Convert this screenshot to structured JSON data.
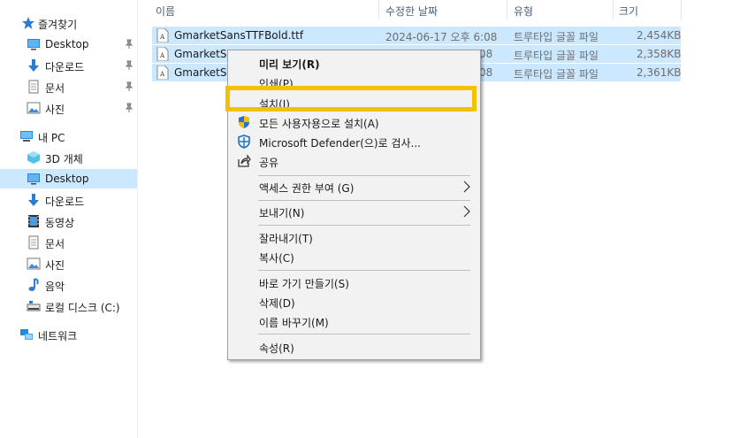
{
  "nav": {
    "quick_access": "즐겨찾기",
    "items_quick": [
      {
        "label": "Desktop",
        "icon": "desktop-icon"
      },
      {
        "label": "다운로드",
        "icon": "download-icon"
      },
      {
        "label": "문서",
        "icon": "document-icon"
      },
      {
        "label": "사진",
        "icon": "picture-icon"
      }
    ],
    "this_pc": "내 PC",
    "items_pc": [
      {
        "label": "3D 개체",
        "icon": "3d-objects-icon"
      },
      {
        "label": "Desktop",
        "icon": "desktop-icon"
      },
      {
        "label": "다운로드",
        "icon": "download-icon"
      },
      {
        "label": "동영상",
        "icon": "video-icon"
      },
      {
        "label": "문서",
        "icon": "document-icon"
      },
      {
        "label": "사진",
        "icon": "picture-icon"
      },
      {
        "label": "음악",
        "icon": "music-icon"
      },
      {
        "label": "로컬 디스크 (C:)",
        "icon": "drive-icon"
      }
    ],
    "network": "네트워크",
    "selected": "Desktop"
  },
  "columns": {
    "name": "이름",
    "modified": "수정한 날짜",
    "type": "유형",
    "size": "크기"
  },
  "files": [
    {
      "name": "GmarketSansTTFBold.ttf",
      "modified": "2024-06-17 오후 6:08",
      "type": "트루타입 글꼴 파일",
      "size": "2,454KB"
    },
    {
      "name": "GmarketSans",
      "modified_tail": "08",
      "type": "트루타입 글꼴 파일",
      "size": "2,358KB"
    },
    {
      "name": "GmarketSan",
      "modified_tail": "08",
      "type": "트루타입 글꼴 파일",
      "size": "2,361KB"
    }
  ],
  "context_menu": {
    "preview": "미리 보기(R)",
    "print": "인쇄(P)",
    "install": "설치(I)",
    "install_all_users": "모든 사용자용으로 설치(A)",
    "defender_scan": "Microsoft Defender(으)로 검사...",
    "share": "공유",
    "give_access": "액세스 권한 부여 (G)",
    "send_to": "보내기(N)",
    "cut": "잘라내기(T)",
    "copy": "복사(C)",
    "create_shortcut": "바로 가기 만들기(S)",
    "delete": "삭제(D)",
    "rename": "이름 바꾸기(M)",
    "properties": "속성(R)"
  },
  "colors": {
    "selection": "#cce8ff",
    "highlight_box": "#f5c000",
    "menu_bg": "#f2f2f2"
  }
}
